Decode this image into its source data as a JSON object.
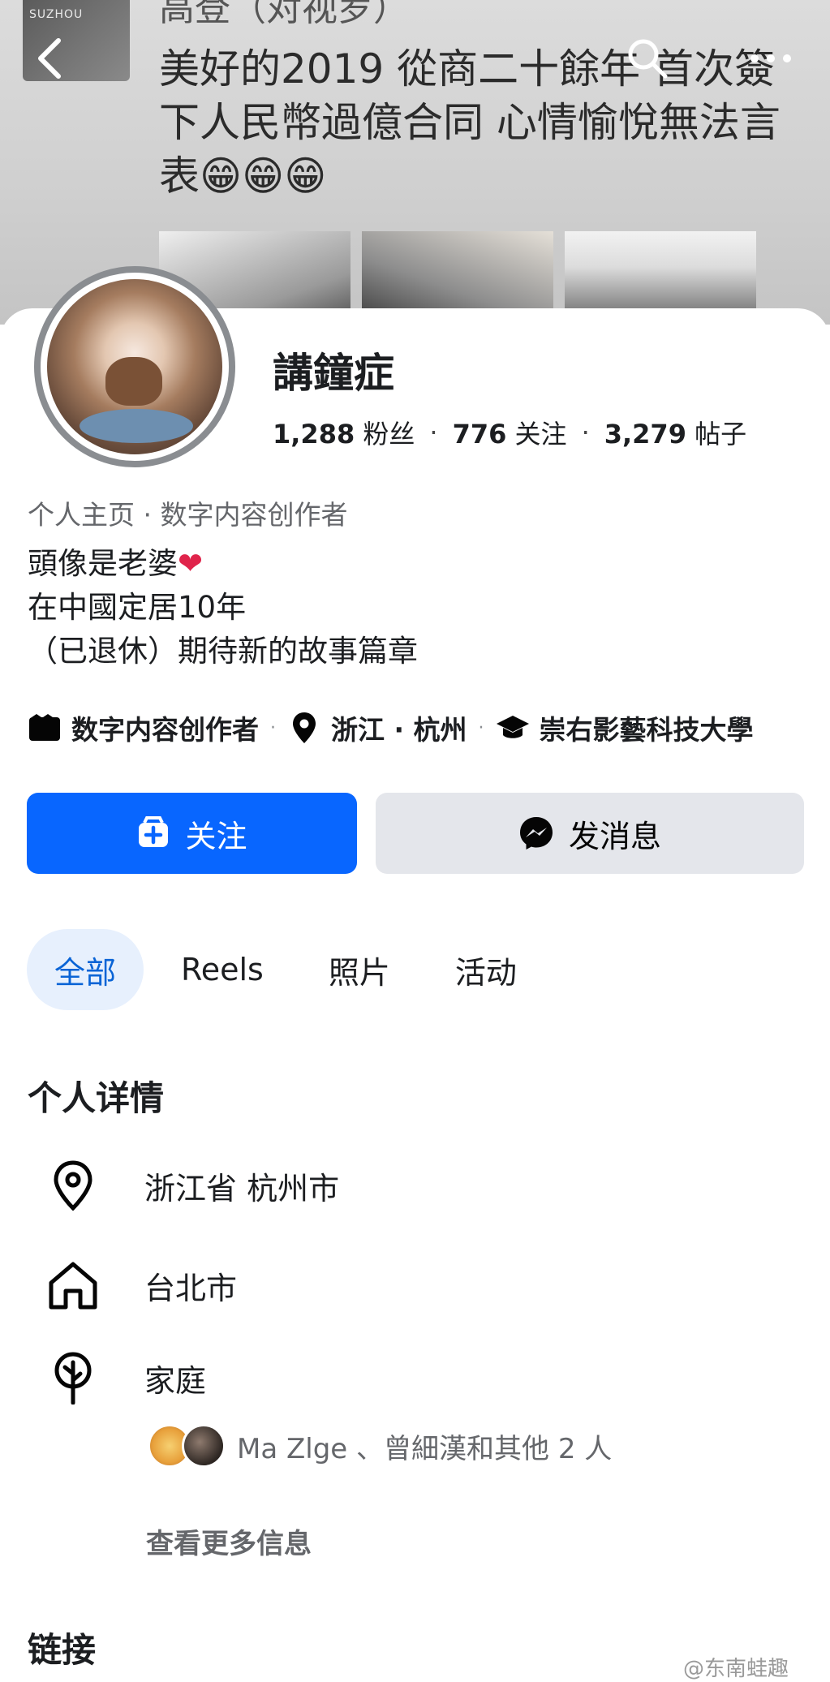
{
  "cover": {
    "thumb_caption": "SUZHOU",
    "top_text": "高登（对视罗）",
    "post_text": "美好的2019 從商二十餘年 首次簽下人民幣過億合同 心情愉悅無法言表😁😁😁"
  },
  "profile": {
    "name": "講鐘症",
    "followers_count": "1,288",
    "followers_label": "粉丝",
    "following_count": "776",
    "following_label": "关注",
    "posts_count": "3,279",
    "posts_label": "帖子",
    "category_line": "个人主页 · 数字内容创作者",
    "bio_line1": "頭像是老婆",
    "bio_heart": "❤",
    "bio_line2": "在中國定居10年",
    "bio_line3": "（已退休）期待新的故事篇章",
    "meta_category": "数字内容创作者",
    "meta_location": "浙江 · 杭州",
    "meta_school": "崇右影藝科技大學"
  },
  "actions": {
    "follow_label": "关注",
    "message_label": "发消息"
  },
  "tabs": [
    {
      "label": "全部",
      "active": true
    },
    {
      "label": "Reels",
      "active": false
    },
    {
      "label": "照片",
      "active": false
    },
    {
      "label": "活动",
      "active": false
    }
  ],
  "details": {
    "title": "个人详情",
    "current_city": "浙江省 杭州市",
    "hometown": "台北市",
    "family_label": "家庭",
    "family_members": "Ma Zlge 、曾細漢和其他 2 人",
    "see_more": "查看更多信息"
  },
  "links": {
    "title": "链接"
  },
  "watermark": "@东南蛙趣",
  "colors": {
    "accent_blue": "#0866ff",
    "tab_active_bg": "#e7f0fd",
    "secondary_button": "#e4e6eb",
    "secondary_text": "#65676b",
    "heart": "#e0244b"
  },
  "icons": {
    "back": "chevron-left-icon",
    "search": "search-icon",
    "more": "more-horizontal-icon",
    "category": "video-clapper-icon",
    "location": "location-pin-icon",
    "school": "graduation-cap-icon",
    "follow": "add-friend-icon",
    "message": "messenger-icon",
    "hometown": "home-icon",
    "family": "family-tree-icon"
  }
}
